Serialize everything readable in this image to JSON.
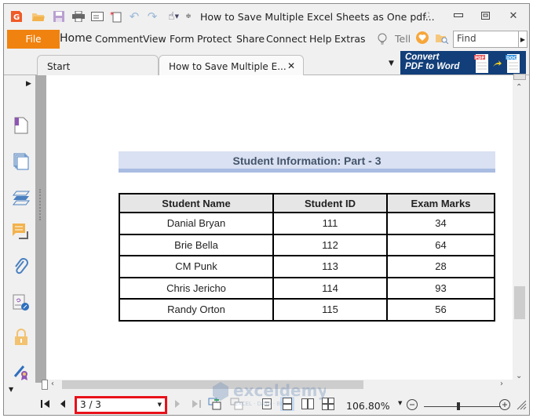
{
  "window": {
    "title": "How to Save Multiple Excel Sheets as One pdf...",
    "quick_access_icons": [
      "app-logo-icon",
      "open-folder-icon",
      "save-icon",
      "print-icon",
      "email-icon",
      "new-document-icon",
      "undo-icon",
      "redo-icon",
      "hand-tool-icon",
      "customize-toolbar-icon"
    ],
    "window_buttons": [
      "full-screen-icon",
      "minimize-icon",
      "restore-icon",
      "close-icon"
    ]
  },
  "menu": {
    "file_label": "File",
    "items": [
      "Home",
      "Comment",
      "View",
      "Form",
      "Protect",
      "Share",
      "Connect",
      "Help",
      "Extras"
    ],
    "tell_label": "Tell",
    "find_placeholder": "Find"
  },
  "tabs": [
    {
      "label": "Start"
    },
    {
      "label": "How to Save Multiple E...",
      "close": "✕"
    }
  ],
  "banner": {
    "line1": "Convert",
    "line2": "PDF to Word",
    "pdf_badge": "PDF",
    "doc_badge": "DOC"
  },
  "sidebar": {
    "items": [
      "bookmarks",
      "pages",
      "layers",
      "comments",
      "attachments",
      "signatures",
      "security",
      "certify"
    ]
  },
  "document": {
    "sheet_title": "Student Information: Part - 3",
    "table": {
      "headers": [
        "Student Name",
        "Student ID",
        "Exam Marks"
      ],
      "rows": [
        [
          "Danial Bryan",
          "111",
          "34"
        ],
        [
          "Brie Bella",
          "112",
          "64"
        ],
        [
          "CM Punk",
          "113",
          "28"
        ],
        [
          "Chris Jericho",
          "114",
          "93"
        ],
        [
          "Randy Orton",
          "115",
          "56"
        ]
      ]
    }
  },
  "statusbar": {
    "page_indicator": "3 / 3",
    "zoom_level": "106.80%",
    "zoom_slider_fraction": 0.45
  },
  "watermark": {
    "brand": "exceldemy",
    "tagline": "EXCEL · DATA · BI"
  },
  "colors": {
    "file_button": "#f0820f",
    "banner": "#123f7a",
    "sheet_title_bg": "#d9e1f2",
    "sheet_title_text": "#44546a",
    "page_box_border": "#e8111a"
  }
}
